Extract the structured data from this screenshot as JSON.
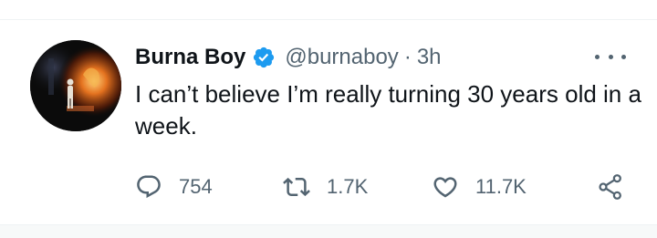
{
  "tweet": {
    "display_name": "Burna Boy",
    "handle": "@burnaboy",
    "separator": "·",
    "time": "3h",
    "text": "I can’t believe I’m really turning 30 years old in a week.",
    "verified": true,
    "accent_color": "#1d9bf0",
    "muted_color": "#536471"
  },
  "actions": {
    "reply": {
      "icon": "reply-icon",
      "count": "754"
    },
    "retweet": {
      "icon": "retweet-icon",
      "count": "1.7K"
    },
    "like": {
      "icon": "heart-icon",
      "count": "11.7K"
    },
    "share": {
      "icon": "share-icon"
    }
  },
  "more_menu": {
    "icon": "more-options-icon"
  }
}
